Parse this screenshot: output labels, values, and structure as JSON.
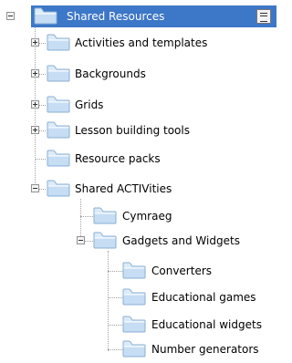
{
  "tree": {
    "root": {
      "label": "Shared Resources",
      "expanded": true,
      "selected": true
    },
    "items": [
      {
        "label": "Activities and templates",
        "expandable": true,
        "expanded": false
      },
      {
        "label": "Backgrounds",
        "expandable": true,
        "expanded": false
      },
      {
        "label": "Grids",
        "expandable": true,
        "expanded": false
      },
      {
        "label": "Lesson building tools",
        "expandable": true,
        "expanded": false
      },
      {
        "label": "Resource packs",
        "expandable": false
      },
      {
        "label": "Shared ACTIVities",
        "expandable": true,
        "expanded": true,
        "children": [
          {
            "label": "Cymraeg",
            "expandable": false
          },
          {
            "label": "Gadgets and Widgets",
            "expandable": true,
            "expanded": true,
            "children": [
              {
                "label": "Converters"
              },
              {
                "label": "Educational games"
              },
              {
                "label": "Educational widgets"
              },
              {
                "label": "Number generators"
              }
            ]
          }
        ]
      }
    ]
  },
  "colors": {
    "selection": "#3d77c7",
    "folder_light": "#cfe4f8",
    "folder_dark": "#8bb6de",
    "connector": "#a0a0a0"
  },
  "icons": {
    "folder": "folder-icon",
    "menu": "menu-icon"
  }
}
